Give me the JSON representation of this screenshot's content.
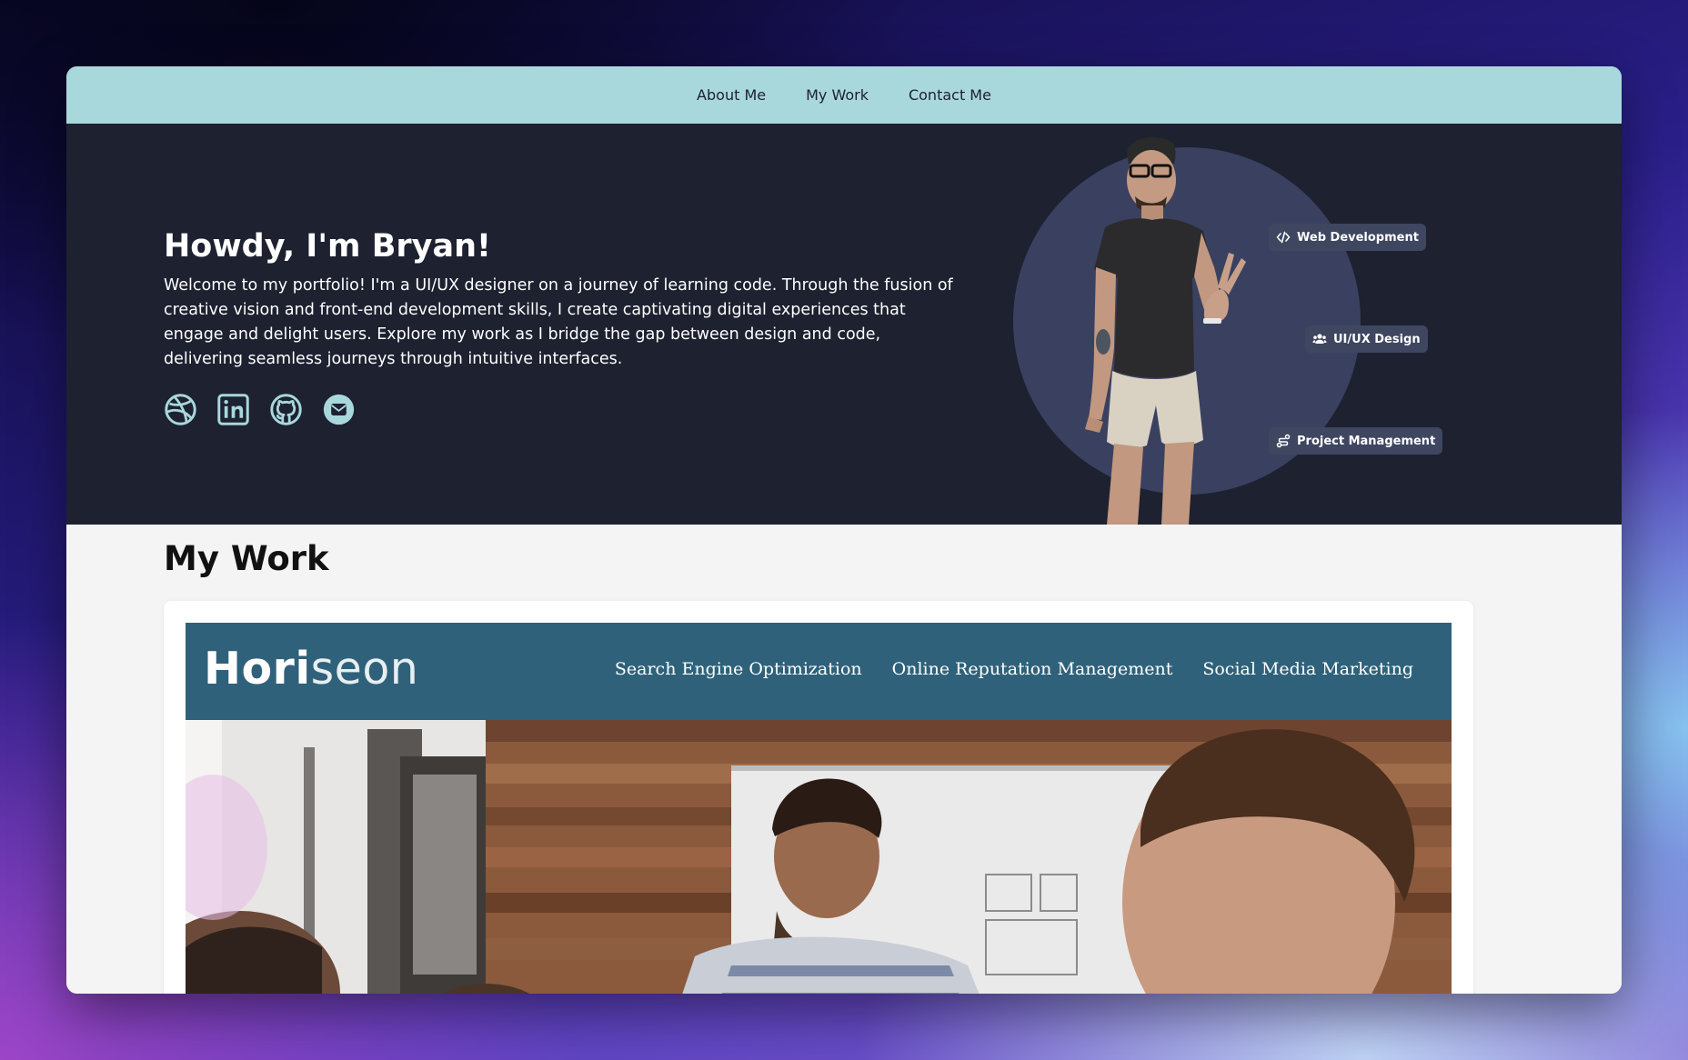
{
  "nav": {
    "items": [
      {
        "label": "About Me"
      },
      {
        "label": "My Work"
      },
      {
        "label": "Contact Me"
      }
    ]
  },
  "hero": {
    "title": "Howdy, I'm Bryan!",
    "description": "Welcome to my portfolio! I'm a UI/UX designer on a journey of learning code. Through the fusion of creative vision and front-end development skills, I create captivating digital experiences that engage and delight users. Explore my work as I bridge the gap between design and code, delivering seamless journeys through intuitive interfaces.",
    "socials": [
      {
        "icon": "dribbble-icon"
      },
      {
        "icon": "linkedin-icon"
      },
      {
        "icon": "github-icon"
      },
      {
        "icon": "email-icon"
      }
    ],
    "badges": [
      {
        "label": "Web Development",
        "icon": "code-icon"
      },
      {
        "label": "UI/UX Design",
        "icon": "users-icon"
      },
      {
        "label": "Project Management",
        "icon": "route-icon"
      }
    ]
  },
  "work": {
    "title": "My Work",
    "project": {
      "logo_bold": "Hori",
      "logo_light": "seon",
      "nav": [
        "Search Engine Optimization",
        "Online Reputation Management",
        "Social Media Marketing"
      ]
    }
  },
  "colors": {
    "nav_bg": "#a8d8dc",
    "hero_bg": "#1d2130",
    "accent": "#a8d8dc",
    "project_header": "#2f627a"
  }
}
